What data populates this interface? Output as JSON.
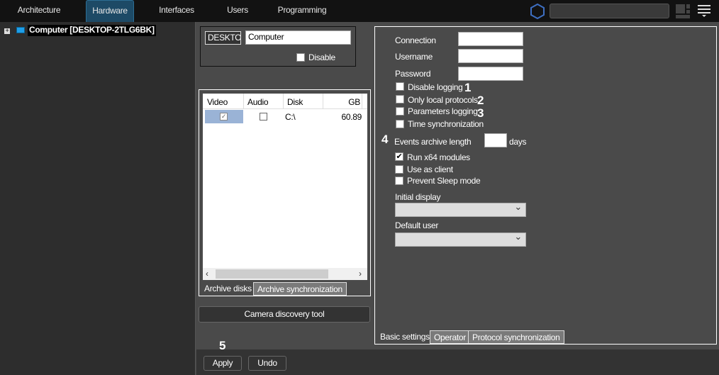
{
  "nav": {
    "tabs": [
      "Architecture",
      "Hardware",
      "Interfaces",
      "Users",
      "Programming"
    ],
    "active": "Hardware",
    "search_value": ""
  },
  "tree": {
    "root_label": "Computer [DESKTOP-2TLG6BK]"
  },
  "computer": {
    "id_value": "DESKTOP",
    "name_value": "Computer",
    "disable_label": "Disable"
  },
  "disks": {
    "headers": [
      "Video",
      "Audio",
      "Disk",
      "GB"
    ],
    "rows": [
      {
        "video": true,
        "audio": false,
        "disk": "C:\\",
        "gb": "60.89"
      }
    ],
    "tabs": [
      "Archive disks",
      "Archive synchronization"
    ]
  },
  "camera_discovery_label": "Camera discovery tool",
  "settings": {
    "connection_label": "Connection",
    "username_label": "Username",
    "password_label": "Password",
    "checkboxes1": [
      {
        "label": "Disable logging",
        "checked": false,
        "marker": "1"
      },
      {
        "label": "Only local protocols",
        "checked": false,
        "marker": "2"
      },
      {
        "label": "Parameters logging",
        "checked": false,
        "marker": "3"
      },
      {
        "label": "Time synchronization",
        "checked": false,
        "marker": ""
      }
    ],
    "events_marker": "4",
    "events_label": "Events archive length",
    "events_value": "",
    "days_label": "days",
    "checkboxes2": [
      {
        "label": "Run x64 modules",
        "checked": true
      },
      {
        "label": "Use as client",
        "checked": false
      },
      {
        "label": "Prevent Sleep mode",
        "checked": false
      }
    ],
    "initial_display_label": "Initial display",
    "default_user_label": "Default user",
    "tabs": [
      "Basic settings",
      "Operator",
      "Protocol synchronization"
    ]
  },
  "apply_marker": "5",
  "apply_label": "Apply",
  "undo_label": "Undo"
}
